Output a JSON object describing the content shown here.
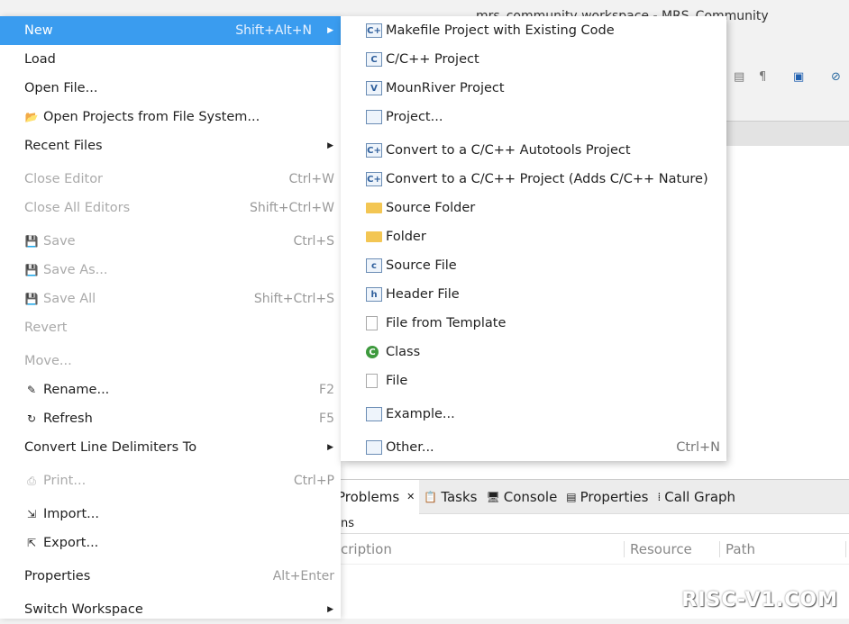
{
  "window": {
    "title": "mrs_community workspace - MRS_Community"
  },
  "file_menu": [
    {
      "label": "New",
      "shortcut": "Shift+Alt+N",
      "submenu": true,
      "selected": true
    },
    {
      "label": "Load"
    },
    {
      "label": "Open File..."
    },
    {
      "label": "Open Projects from File System...",
      "icon": "folder-icon"
    },
    {
      "label": "Recent Files",
      "submenu": true
    },
    {
      "label": "Close Editor",
      "shortcut": "Ctrl+W",
      "disabled": true,
      "gap": true
    },
    {
      "label": "Close All Editors",
      "shortcut": "Shift+Ctrl+W",
      "disabled": true
    },
    {
      "label": "Save",
      "shortcut": "Ctrl+S",
      "disabled": true,
      "icon": "save-icon",
      "gap": true
    },
    {
      "label": "Save As...",
      "disabled": true,
      "icon": "save-as-icon"
    },
    {
      "label": "Save All",
      "shortcut": "Shift+Ctrl+S",
      "disabled": true,
      "icon": "save-all-icon"
    },
    {
      "label": "Revert",
      "disabled": true
    },
    {
      "label": "Move...",
      "disabled": true,
      "gap": true
    },
    {
      "label": "Rename...",
      "shortcut": "F2",
      "icon": "rename-icon"
    },
    {
      "label": "Refresh",
      "shortcut": "F5",
      "icon": "refresh-icon"
    },
    {
      "label": "Convert Line Delimiters To",
      "submenu": true
    },
    {
      "label": "Print...",
      "shortcut": "Ctrl+P",
      "disabled": true,
      "icon": "print-icon",
      "gap": true
    },
    {
      "label": "Import...",
      "icon": "import-icon",
      "gap": true
    },
    {
      "label": "Export...",
      "icon": "export-icon"
    },
    {
      "label": "Properties",
      "shortcut": "Alt+Enter",
      "gap": true
    },
    {
      "label": "Switch Workspace",
      "submenu": true,
      "gap": true
    }
  ],
  "new_submenu": [
    {
      "label": "Makefile Project with Existing Code",
      "icon": "makefile-project-icon",
      "glyph": "C+"
    },
    {
      "label": "C/C++ Project",
      "icon": "cpp-project-icon",
      "glyph": "C"
    },
    {
      "label": "MounRiver Project",
      "icon": "mounriver-project-icon",
      "glyph": "V"
    },
    {
      "label": "Project...",
      "icon": "project-icon",
      "glyph": ""
    },
    {
      "label": "Convert to a C/C++ Autotools Project",
      "icon": "convert-icon",
      "glyph": "C+",
      "gap": true
    },
    {
      "label": "Convert to a C/C++ Project (Adds C/C++ Nature)",
      "icon": "convert-icon",
      "glyph": "C+"
    },
    {
      "label": "Source Folder",
      "icon": "source-folder-icon",
      "glyph": "",
      "kind": "fold"
    },
    {
      "label": "Folder",
      "icon": "folder-icon",
      "glyph": "",
      "kind": "fold"
    },
    {
      "label": "Source File",
      "icon": "source-file-icon",
      "glyph": "c"
    },
    {
      "label": "Header File",
      "icon": "header-file-icon",
      "glyph": "h"
    },
    {
      "label": "File from Template",
      "icon": "file-template-icon",
      "glyph": "",
      "kind": "file"
    },
    {
      "label": "Class",
      "icon": "class-icon",
      "glyph": "C",
      "kind": "cls"
    },
    {
      "label": "File",
      "icon": "file-icon",
      "glyph": "",
      "kind": "file"
    },
    {
      "label": "Example...",
      "icon": "example-icon",
      "glyph": "",
      "gap": true
    },
    {
      "label": "Other...",
      "shortcut": "Ctrl+N",
      "icon": "other-icon",
      "glyph": "",
      "gap": true
    }
  ],
  "bottom_panel": {
    "tabs": [
      {
        "label": "Problems",
        "icon": "problems-icon",
        "active": true
      },
      {
        "label": "Tasks",
        "icon": "tasks-icon"
      },
      {
        "label": "Console",
        "icon": "console-icon"
      },
      {
        "label": "Properties",
        "icon": "properties-icon"
      },
      {
        "label": "Call Graph",
        "icon": "call-graph-icon"
      }
    ],
    "summary": "ns",
    "columns": [
      "cription",
      "Resource",
      "Path"
    ]
  },
  "watermark": "RISC-V1.COM",
  "colors": {
    "selection": "#3a9cef"
  }
}
